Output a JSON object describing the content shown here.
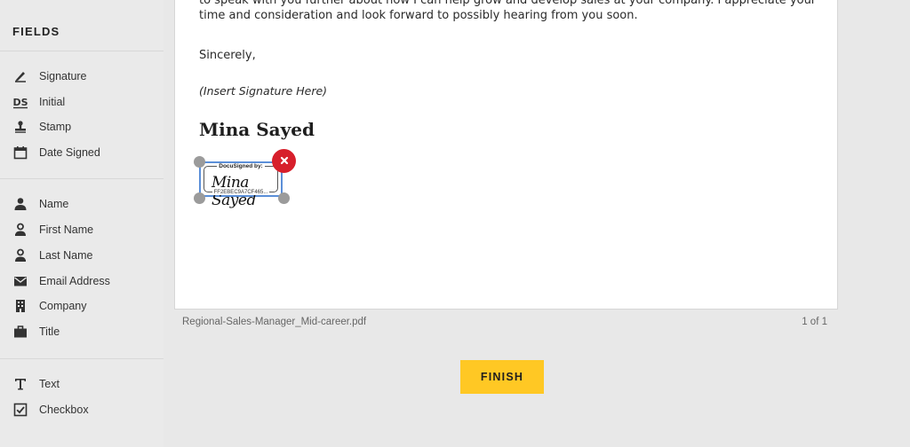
{
  "sidebar": {
    "title": "FIELDS",
    "groups": [
      [
        {
          "label": "Signature",
          "icon": "pen-icon"
        },
        {
          "label": "Initial",
          "icon": "ds-initial-icon"
        },
        {
          "label": "Stamp",
          "icon": "stamp-icon"
        },
        {
          "label": "Date Signed",
          "icon": "calendar-icon"
        }
      ],
      [
        {
          "label": "Name",
          "icon": "person-icon"
        },
        {
          "label": "First Name",
          "icon": "person-outline-icon"
        },
        {
          "label": "Last Name",
          "icon": "person-outline-icon"
        },
        {
          "label": "Email Address",
          "icon": "envelope-icon"
        },
        {
          "label": "Company",
          "icon": "building-icon"
        },
        {
          "label": "Title",
          "icon": "briefcase-icon"
        }
      ],
      [
        {
          "label": "Text",
          "icon": "text-t-icon"
        },
        {
          "label": "Checkbox",
          "icon": "checkbox-icon"
        }
      ]
    ]
  },
  "document": {
    "paragraph": "to speak with you further about how I can help grow and develop sales at your company. I appreciate your time and consideration and look forward to possibly hearing from you soon.",
    "closing": "Sincerely,",
    "signature_placeholder": "(Insert Signature Here)",
    "signer_name": "Mina Sayed",
    "signature_tag": {
      "header": "DocuSigned by:",
      "signature": "Mina Sayed",
      "id": "FF2EBEC9A7CF465..."
    }
  },
  "footer": {
    "filename": "Regional-Sales-Manager_Mid-career.pdf",
    "page_count": "1 of 1",
    "finish_label": "FINISH"
  },
  "colors": {
    "accent": "#ffc824",
    "delete": "#d71f2b",
    "selection": "#5b8fd8"
  }
}
